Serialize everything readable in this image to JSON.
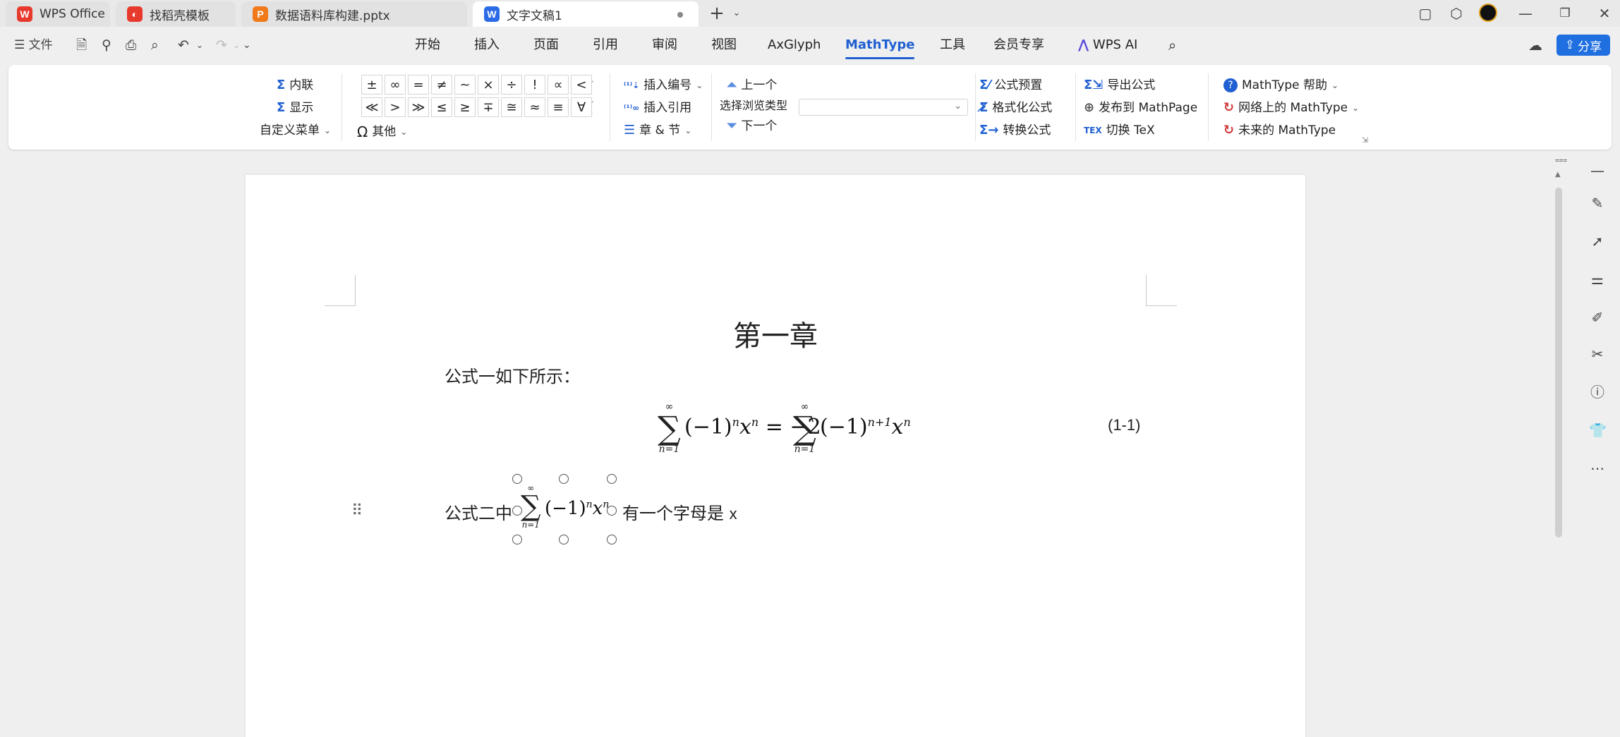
{
  "tabs": [
    {
      "label": "WPS Office",
      "icon": "wps-logo-icon",
      "color": "#e8392d",
      "glyph": "W"
    },
    {
      "label": "找稻壳模板",
      "icon": "docer-icon",
      "color": "#e8392d",
      "glyph": "◐"
    },
    {
      "label": "数据语料库构建.pptx",
      "icon": "presentation-icon",
      "color": "#f07a1a",
      "glyph": "P"
    },
    {
      "label": "文字文稿1",
      "icon": "writer-icon",
      "color": "#2b6be6",
      "glyph": "W"
    }
  ],
  "new_tab_label": "+",
  "quick_access": {
    "file_label": "文件"
  },
  "menu": [
    "开始",
    "插入",
    "页面",
    "引用",
    "审阅",
    "视图",
    "AxGlyph",
    "MathType",
    "工具",
    "会员专享",
    "WPS AI"
  ],
  "active_menu": "MathType",
  "share_label": "分享",
  "ribbon": {
    "inline_label": "内联",
    "display_label": "显示",
    "custom_menu_label": "自定义菜单",
    "symbols_row1": [
      "±",
      "∞",
      "=",
      "≠",
      "~",
      "×",
      "÷",
      "!",
      "∝",
      "<"
    ],
    "symbols_row2": [
      "≪",
      ">",
      "≫",
      "≤",
      "≥",
      "∓",
      "≅",
      "≈",
      "≡",
      "∀"
    ],
    "other_label": "其他",
    "insert_number_label": "插入编号",
    "insert_ref_label": "插入引用",
    "chapter_section_label": "章 & 节",
    "prev_label": "上一个",
    "browse_type_label": "选择浏览类型",
    "next_label": "下一个",
    "preset_label": "公式预置",
    "format_label": "格式化公式",
    "convert_label": "转换公式",
    "export_label": "导出公式",
    "publish_label": "发布到 MathPage",
    "toggle_tex_label": "切换 TeX",
    "help_label": "MathType 帮助",
    "online_label": "网络上的 MathType",
    "future_label": "未来的 MathType"
  },
  "document": {
    "chapter_title": "第一章",
    "para1": "公式一如下所示：",
    "eq1": {
      "left": "(−1)",
      "left_exp": "n",
      "left_x": "x",
      "left_x_exp": "n",
      "equals": "= −2",
      "right": "(−1)",
      "right_exp": "n+1",
      "right_x": "x",
      "right_x_exp": "n",
      "upper": "∞",
      "lower": "n=1",
      "number": "(1-1)"
    },
    "para2_before": "公式二中",
    "para2_after": "有一个字母是",
    "para2_letter": "x"
  },
  "accent_color": "#1f5fd1"
}
